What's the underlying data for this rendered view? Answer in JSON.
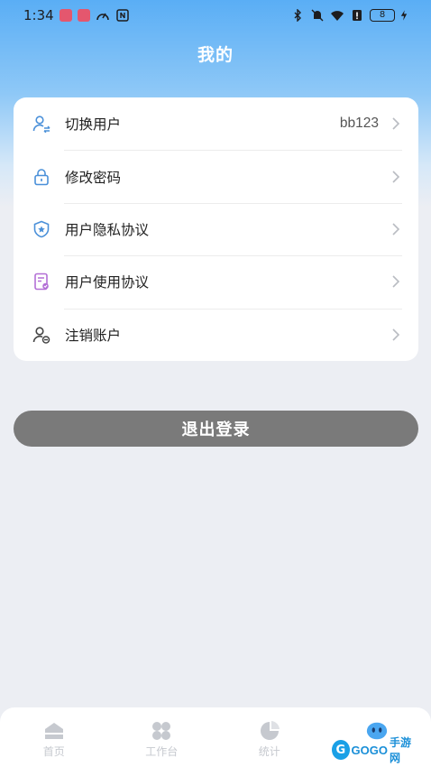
{
  "status_bar": {
    "time": "1:34",
    "battery": "8"
  },
  "header": {
    "title": "我的"
  },
  "menu": {
    "items": [
      {
        "label": "切换用户",
        "value": "bb123",
        "icon": "switch-user-icon"
      },
      {
        "label": "修改密码",
        "value": "",
        "icon": "lock-icon"
      },
      {
        "label": "用户隐私协议",
        "value": "",
        "icon": "shield-icon"
      },
      {
        "label": "用户使用协议",
        "value": "",
        "icon": "document-icon"
      },
      {
        "label": "注销账户",
        "value": "",
        "icon": "user-remove-icon"
      }
    ]
  },
  "actions": {
    "logout_label": "退出登录"
  },
  "bottom_nav": {
    "tabs": [
      {
        "label": "首页",
        "icon": "home-icon"
      },
      {
        "label": "工作台",
        "icon": "grid-icon"
      },
      {
        "label": "统计",
        "icon": "pie-chart-icon"
      },
      {
        "label": "",
        "icon": "robot-avatar-icon"
      }
    ]
  },
  "watermark": {
    "brand": "GOGO",
    "suffix": "手游网"
  },
  "colors": {
    "header_gradient_top": "#5aaef5",
    "logout_button": "#7a7a7a",
    "icon_blue": "#4a90d9",
    "icon_purple": "#b36fd6"
  }
}
